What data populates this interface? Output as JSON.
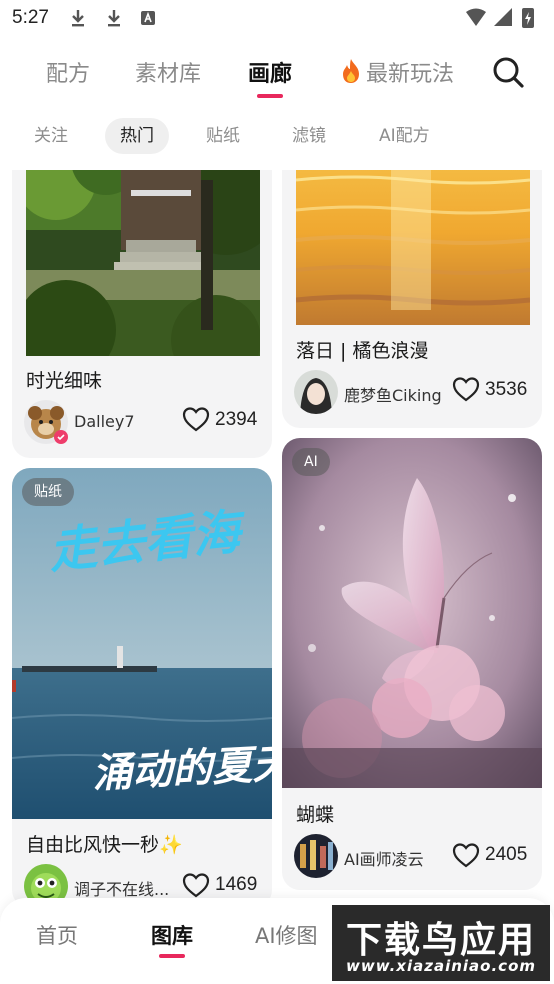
{
  "status_bar": {
    "time": "5:27"
  },
  "top_tabs": [
    {
      "label": "配方"
    },
    {
      "label": "素材库"
    },
    {
      "label": "画廊"
    },
    {
      "label": "最新玩法"
    }
  ],
  "sub_tabs": [
    {
      "label": "关注"
    },
    {
      "label": "热门"
    },
    {
      "label": "贴纸"
    },
    {
      "label": "滤镜"
    },
    {
      "label": "AI配方"
    }
  ],
  "feed": {
    "cards": [
      {
        "title": "时光细味",
        "author": "Dalley7",
        "likes": "2394"
      },
      {
        "title": "落日 | 橘色浪漫",
        "author": "鹿梦鱼Ciking",
        "likes": "3536"
      },
      {
        "badge": "贴纸",
        "title": "自由比风快一秒",
        "emoji": "✨",
        "author": "调子不在线...",
        "likes": "1469",
        "overlay_top": "走去看海",
        "overlay_bottom": "涌动的夏天"
      },
      {
        "badge": "AI",
        "title": "蝴蝶",
        "author": "AI画师凌云",
        "likes": "2405"
      }
    ]
  },
  "bottom_nav": [
    {
      "label": "首页"
    },
    {
      "label": "图库"
    },
    {
      "label": "AI修图"
    }
  ],
  "watermark": {
    "text": "下载鸟应用",
    "url": "www.xiazainiao.com"
  },
  "colors": {
    "accent": "#e8285c",
    "card_bg": "#f4f4f5"
  }
}
